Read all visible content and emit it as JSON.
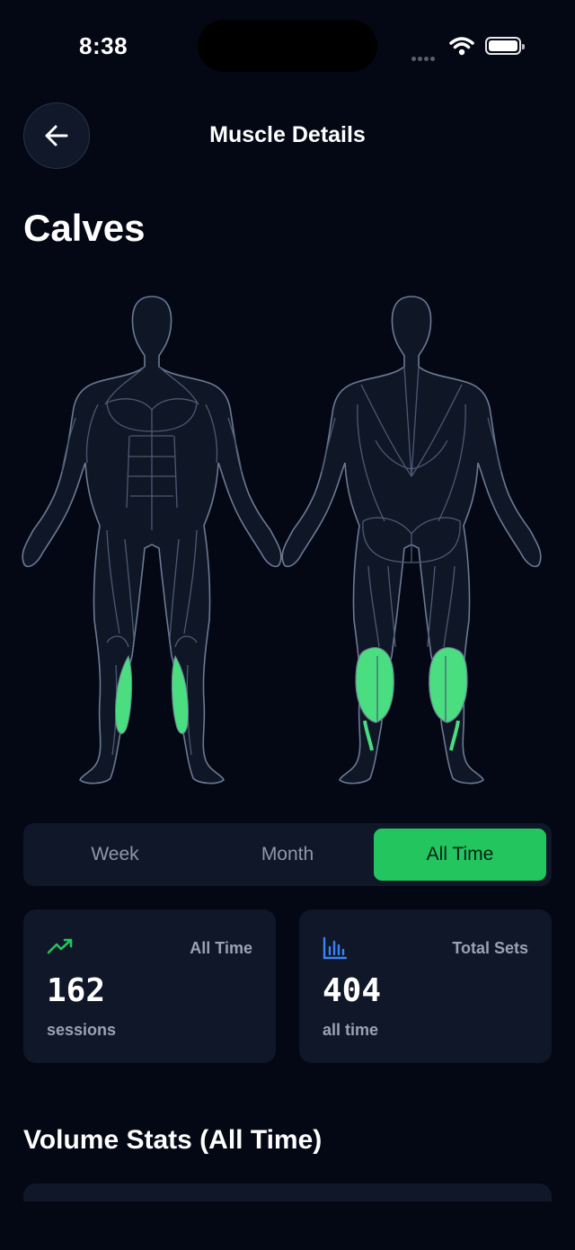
{
  "status_bar": {
    "time": "8:38"
  },
  "header": {
    "title": "Muscle Details"
  },
  "muscle": {
    "name": "Calves",
    "highlight_color": "#4ade80"
  },
  "time_range": {
    "options": [
      "Week",
      "Month",
      "All Time"
    ],
    "selected": "All Time"
  },
  "stats": [
    {
      "icon": "trending-up-icon",
      "label": "All Time",
      "value": "162",
      "sub": "sessions",
      "icon_color": "#22c55e"
    },
    {
      "icon": "bar-chart-icon",
      "label": "Total Sets",
      "value": "404",
      "sub": "all time",
      "icon_color": "#3b82f6"
    }
  ],
  "volume_section": {
    "title": "Volume Stats (All Time)"
  },
  "colors": {
    "background": "#040815",
    "card": "#0f1729",
    "accent": "#22c55e",
    "outline": "#6b7a93"
  }
}
